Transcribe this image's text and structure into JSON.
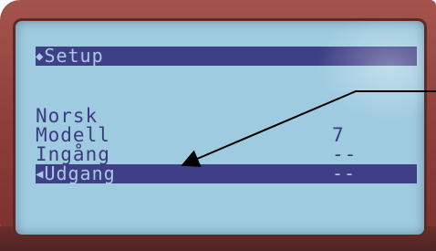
{
  "display": {
    "header": "Setup",
    "header_marker": "◆",
    "selection_marker": "◀",
    "items": [
      {
        "label": "Norsk",
        "value": ""
      },
      {
        "label": "Modell",
        "value": "7"
      },
      {
        "label": "Ingång",
        "value": "--"
      },
      {
        "label": "Udgang",
        "value": "--"
      }
    ],
    "selected_index": 3
  },
  "colors": {
    "bezel": "#8e3e39",
    "lcd_background": "#9fcbe0",
    "lcd_text": "#3b3b80",
    "highlight_bar": "#3f3f87",
    "annotation_line": "#000000"
  }
}
